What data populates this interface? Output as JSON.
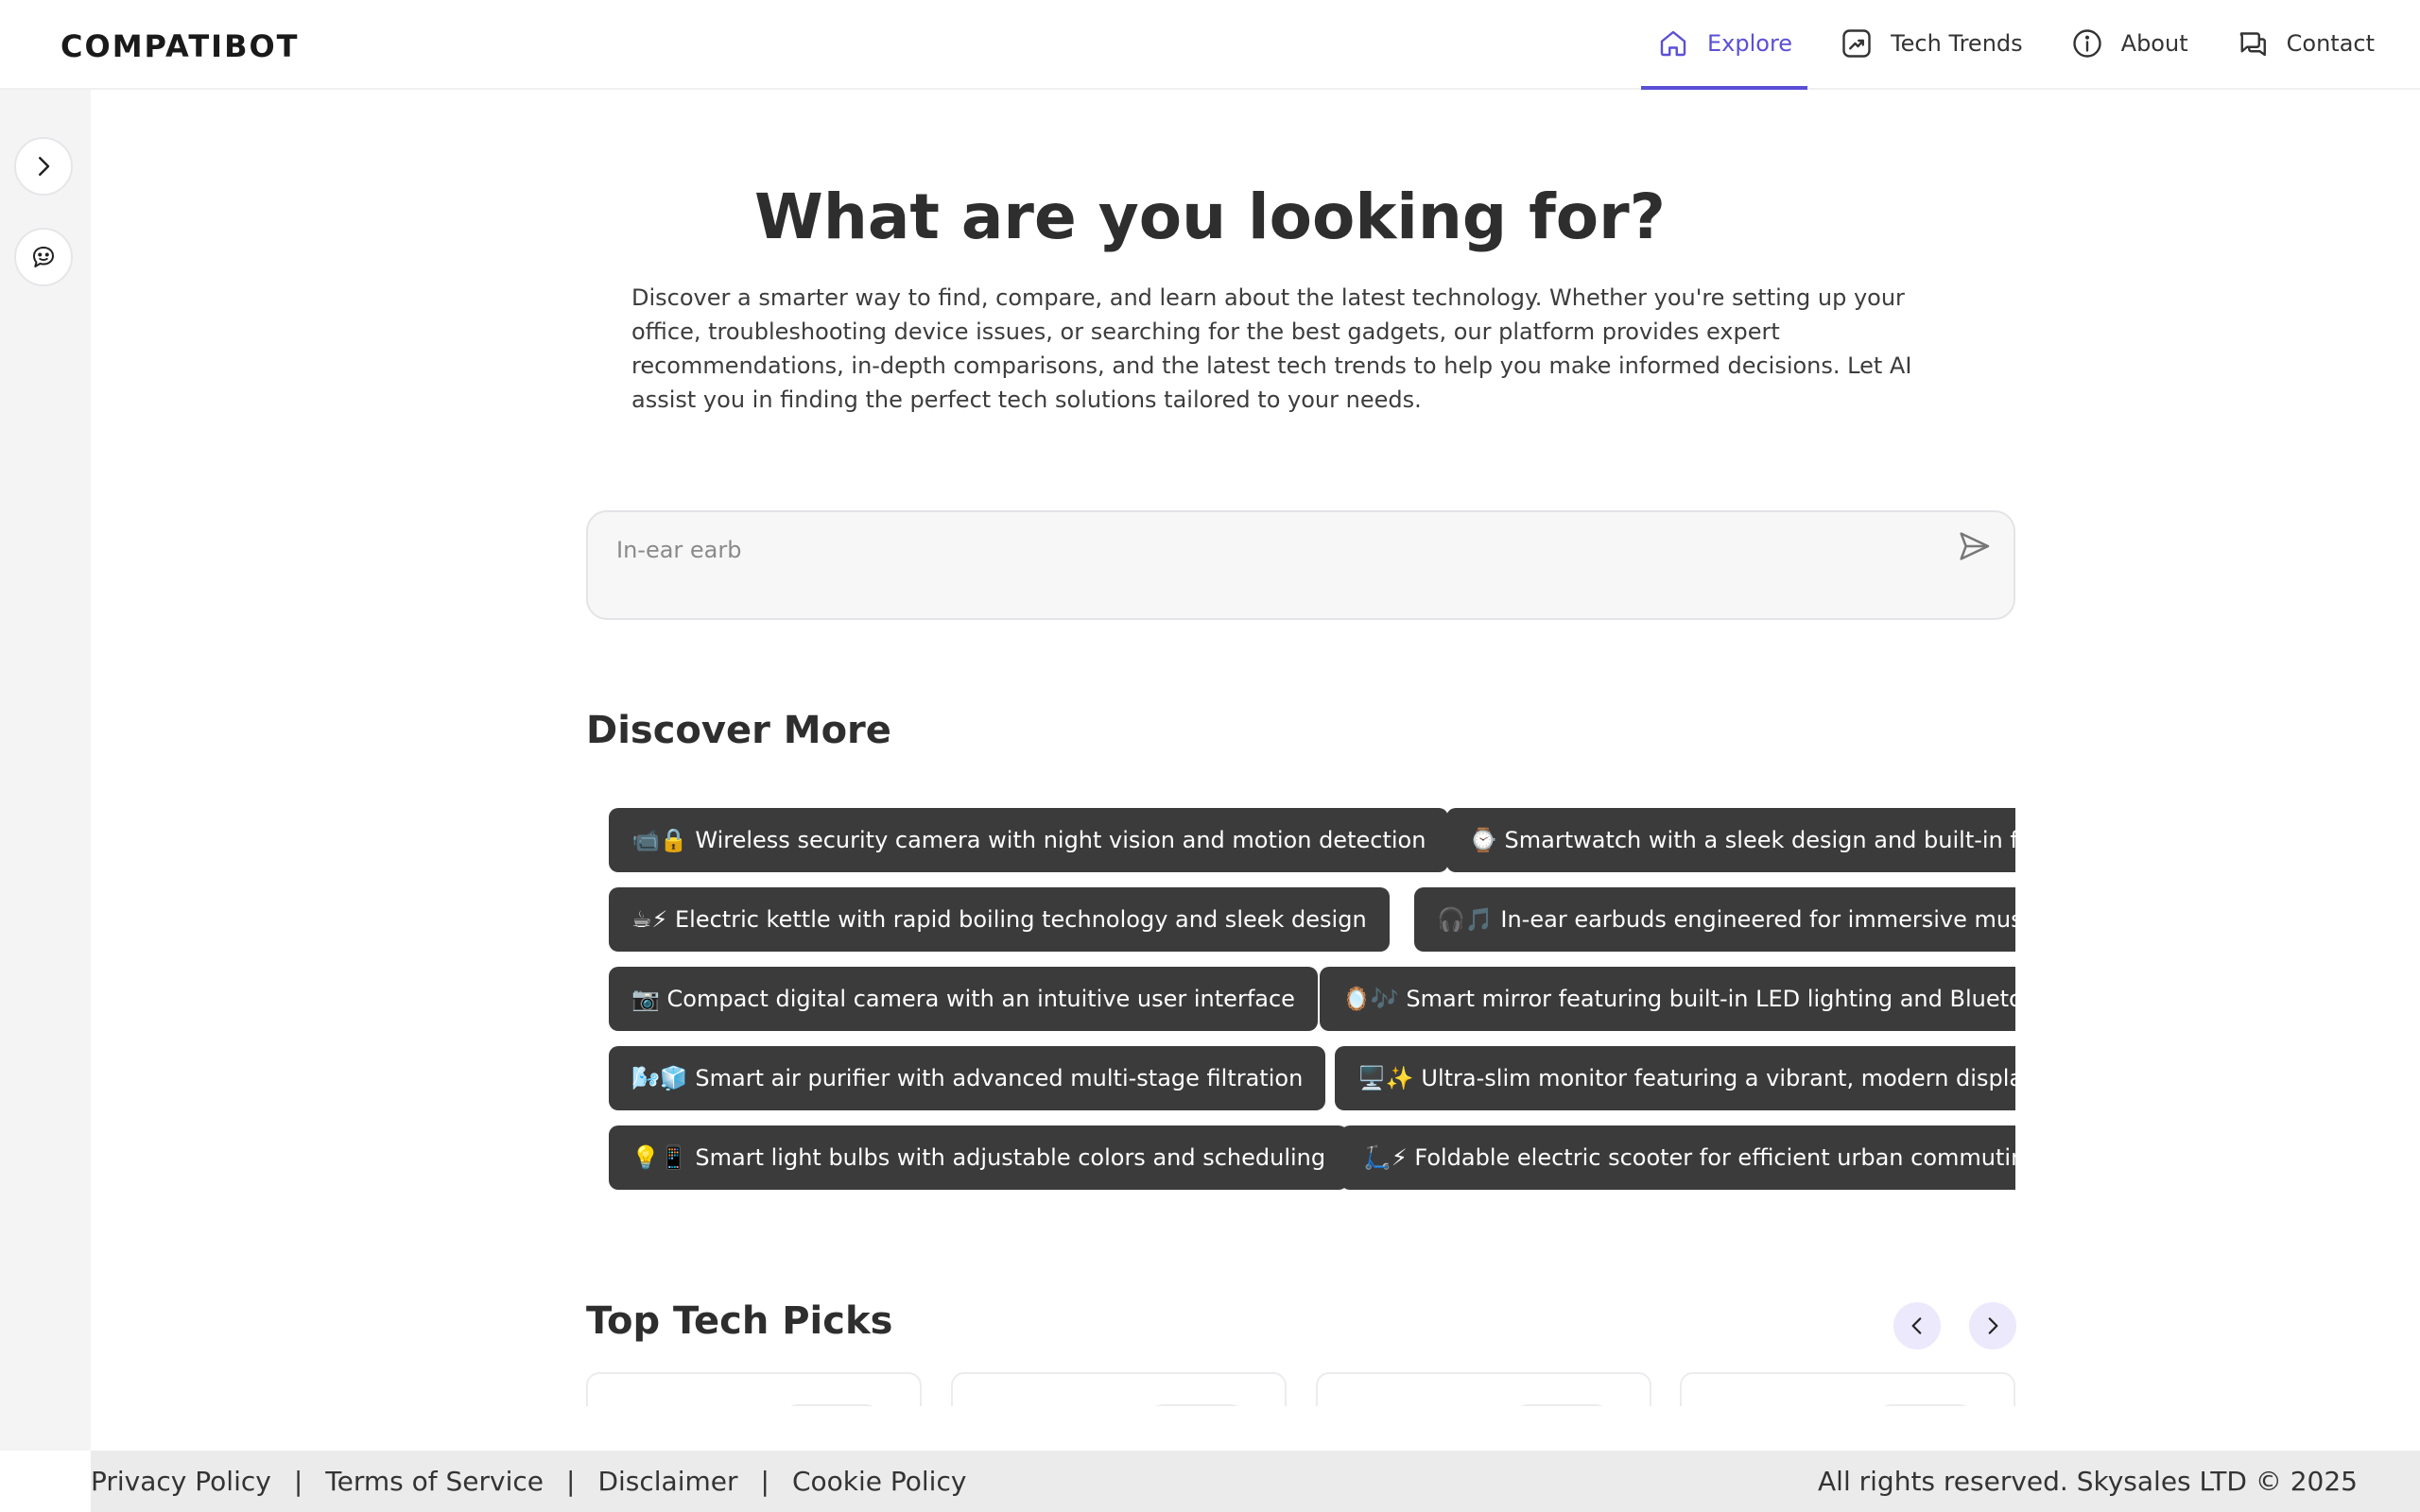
{
  "brand": {
    "logo_text": "COMPATIBOT"
  },
  "nav": {
    "items": [
      {
        "label": "Explore",
        "icon": "home-icon",
        "active": true
      },
      {
        "label": "Tech Trends",
        "icon": "trend-icon",
        "active": false
      },
      {
        "label": "About",
        "icon": "info-icon",
        "active": false
      },
      {
        "label": "Contact",
        "icon": "chat-icon",
        "active": false
      }
    ]
  },
  "sidebar": {
    "toggle_icon": "chevron-right-icon",
    "assistant_icon": "bot-chat-icon"
  },
  "hero": {
    "title": "What are you looking for?",
    "description": "Discover a smarter way to find, compare, and learn about the latest technology. Whether you're setting up your office, troubleshooting device issues, or searching for the best gadgets, our platform provides expert recommendations, in-depth comparisons, and the latest tech trends to help you make informed decisions. Let AI assist you in finding the perfect tech solutions tailored to your needs."
  },
  "search": {
    "placeholder": "In-ear earb",
    "send_icon": "send-icon"
  },
  "discover": {
    "title": "Discover More",
    "chips": [
      "📹🔒 Wireless security camera with night vision and motion detection",
      "⌚ Smartwatch with a sleek design and built-in fitness tracking",
      "☕⚡ Electric kettle with rapid boiling technology and sleek design",
      "🎧🎵 In-ear earbuds engineered for immersive music",
      "📷 Compact digital camera with an intuitive user interface",
      "🪞🎶 Smart mirror featuring built-in LED lighting and Bluetooth speakers",
      "🌬️🧊 Smart air purifier with advanced multi-stage filtration",
      "🖥️✨ Ultra-slim monitor featuring a vibrant, modern display",
      "💡📱 Smart light bulbs with adjustable colors and scheduling",
      "🛴⚡ Foldable electric scooter for efficient urban commuting"
    ]
  },
  "top_picks": {
    "title": "Top Tech Picks",
    "prev_icon": "chevron-left-icon",
    "next_icon": "chevron-right-icon"
  },
  "footer": {
    "links": [
      "Privacy Policy",
      "Terms of Service",
      "Disclaimer",
      "Cookie Policy"
    ],
    "separator": "|",
    "copyright": "All rights reserved. Skysales LTD © 2025"
  },
  "colors": {
    "accent": "#5b4fd6",
    "chip_bg": "#3b3b3b",
    "sidebar_bg": "#f4f4f5",
    "footer_bg": "#ebebeb"
  }
}
